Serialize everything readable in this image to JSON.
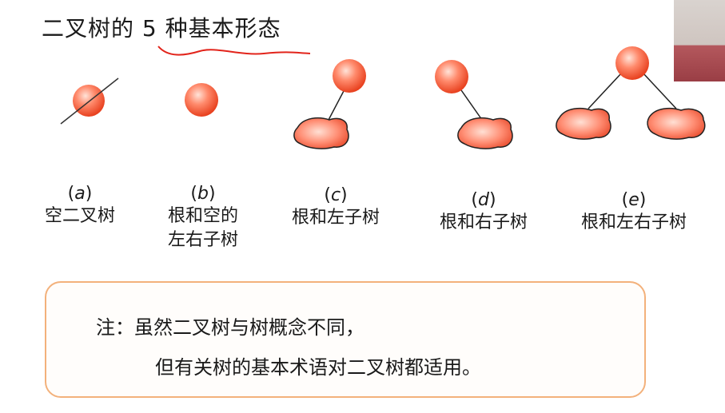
{
  "title": "二叉树的 5 种基本形态",
  "forms": [
    {
      "letter": "a",
      "label_lines": [
        "空二叉树"
      ]
    },
    {
      "letter": "b",
      "label_lines": [
        "根和空的",
        "左右子树"
      ]
    },
    {
      "letter": "c",
      "label_lines": [
        "根和左子树"
      ]
    },
    {
      "letter": "d",
      "label_lines": [
        "根和右子树"
      ]
    },
    {
      "letter": "e",
      "label_lines": [
        "根和左右子树"
      ]
    }
  ],
  "note": {
    "line1": "注：虽然二叉树与树概念不同，",
    "line2": "但有关树的基本术语对二叉树都适用。"
  },
  "colors": {
    "node_fill": "#f15a3a",
    "node_highlight": "#ffd5c4",
    "note_border": "#f3b17b",
    "underline": "#e2241b"
  }
}
